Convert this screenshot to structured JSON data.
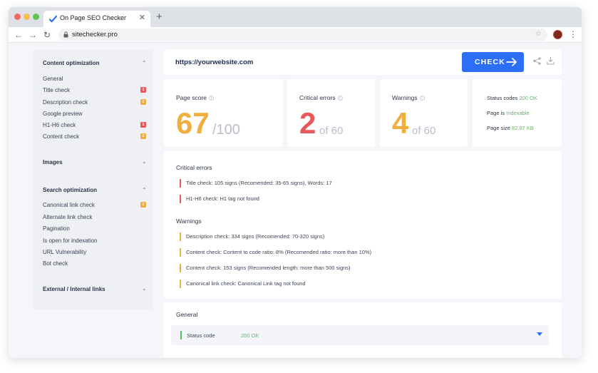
{
  "browser": {
    "tab_title": "On Page SEO Checker",
    "tab_close": "✕",
    "new_tab": "+",
    "url": "sitechecker.pro",
    "nav": {
      "back": "←",
      "forward": "→",
      "reload": "↻"
    },
    "star": "☆",
    "menu": "⋮"
  },
  "sidebar": {
    "sections": [
      {
        "title": "Content optimization",
        "chevron": "⌃",
        "items": [
          {
            "label": "General"
          },
          {
            "label": "Title check",
            "badge": "1",
            "badge_color": "#e9585a"
          },
          {
            "label": "Description check",
            "badge": "1",
            "badge_color": "#f0ae3e"
          },
          {
            "label": "Google preview"
          },
          {
            "label": "H1-H6 check",
            "badge": "1",
            "badge_color": "#e9585a"
          },
          {
            "label": "Content check",
            "badge": "2",
            "badge_color": "#f0ae3e"
          }
        ]
      },
      {
        "title": "Images",
        "chevron": "⌄",
        "items": []
      },
      {
        "title": "Search optimization",
        "chevron": "⌃",
        "items": [
          {
            "label": "Canonical link check",
            "badge": "1",
            "badge_color": "#f0ae3e"
          },
          {
            "label": "Alternate link check"
          },
          {
            "label": "Pagination"
          },
          {
            "label": "Is open for indexation"
          },
          {
            "label": "URL Vulnerability"
          },
          {
            "label": "Bot check"
          }
        ]
      },
      {
        "title": "External / Internal links",
        "chevron": "⌄",
        "items": []
      }
    ]
  },
  "checker": {
    "url_value": "https://yourwebsite.com",
    "check_label": "CHECK"
  },
  "stats": {
    "page_score": {
      "label": "Page score",
      "value": "67",
      "max": "/100",
      "color": "#f0ae3e"
    },
    "critical": {
      "label": "Critical errors",
      "value": "2",
      "of": "of 60",
      "color": "#e9585a"
    },
    "warnings": {
      "label": "Warnings",
      "value": "4",
      "of": "of 60",
      "color": "#f0ae3e"
    },
    "status": {
      "codes_label": "Status codes",
      "codes_value": "200 OK",
      "page_is_label": "Page is",
      "page_is_value": "Indexable",
      "size_label": "Page size",
      "size_value": "82.97 KB"
    }
  },
  "report": {
    "critical_title": "Critical errors",
    "critical_items": [
      "Title check: 105 signs (Recomended: 35-65 signs), Words: 17",
      "H1-H6 check: H1 tag not found"
    ],
    "warnings_title": "Warnings",
    "warning_items": [
      "Description check: 334 signs (Recomended: 70-320 signs)",
      "Content check: Content to code ratio: 8% (Recomended ratio: more than 10%)",
      "Content check: 153 signs (Recomended length: more than 500 signs)",
      "Canonical link check: Canonical Link tag not found"
    ]
  },
  "general": {
    "title": "General",
    "row_label": "Status code",
    "row_value": "200 OK"
  },
  "colors": {
    "accent": "#2d6ef7",
    "red": "#e9585a",
    "orange": "#f0ae3e",
    "green": "#58be60"
  }
}
